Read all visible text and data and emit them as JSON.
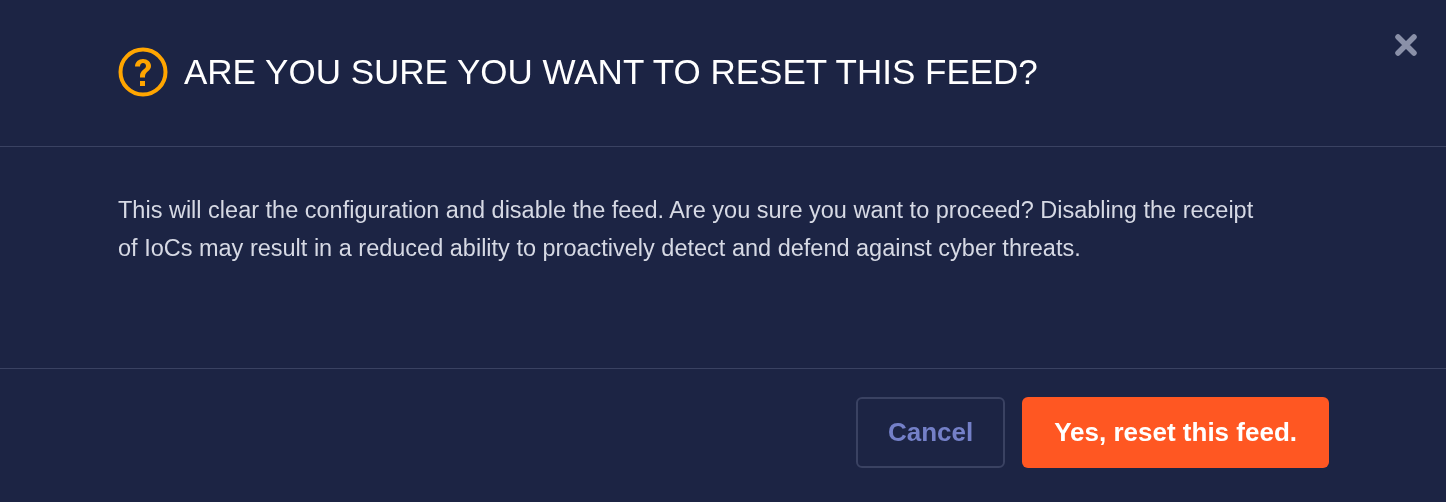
{
  "dialog": {
    "title": "ARE YOU SURE YOU WANT TO RESET THIS FEED?",
    "message": "This will clear the configuration and disable the feed. Are you sure you want to proceed? Disabling the receipt of IoCs may result in a reduced ability to proactively detect and defend against cyber threats.",
    "buttons": [
      {
        "label": "Cancel",
        "kind": "secondary"
      },
      {
        "label": "Yes, reset this feed.",
        "kind": "primary"
      }
    ]
  }
}
